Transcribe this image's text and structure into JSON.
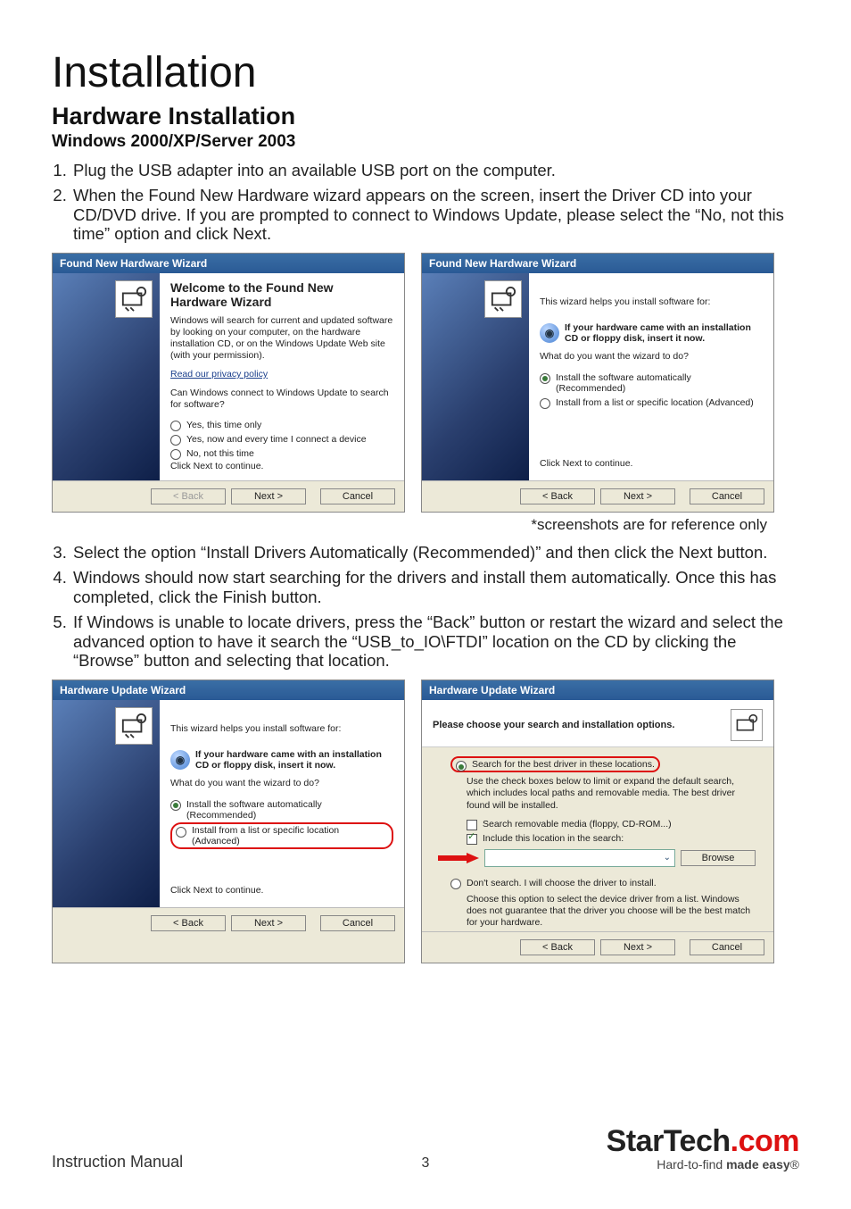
{
  "doc": {
    "title": "Installation",
    "subtitle": "Hardware Installation",
    "subsub": "Windows 2000/XP/Server 2003",
    "steps1": [
      "Plug the USB adapter into an available USB port on the computer.",
      "When the Found New Hardware wizard appears on the screen, insert the Driver CD into your CD/DVD drive. If you are prompted to connect to Windows Update, please select the “No, not this time” option and click Next."
    ],
    "caption": "*screenshots are for reference only",
    "steps2": [
      "Select the option “Install Drivers Automatically (Recommended)” and then click the Next button.",
      "Windows should now start searching for the drivers and install them automatically. Once this has completed, click the Finish button.",
      "If Windows is unable to locate drivers, press the “Back” button or restart the wizard and select the advanced option to have it search the “USB_to_IO\\FTDI” location on the CD by clicking the “Browse” button and selecting that location."
    ]
  },
  "wizA": {
    "title": "Found New Hardware Wizard",
    "heading": "Welcome to the Found New Hardware Wizard",
    "intro": "Windows will search for current and updated software by looking on your computer, on the hardware installation CD, or on the Windows Update Web site (with your permission).",
    "privacy": "Read our privacy policy",
    "question": "Can Windows connect to Windows Update to search for software?",
    "opts": [
      "Yes, this time only",
      "Yes, now and every time I connect a device",
      "No, not this time"
    ],
    "cont": "Click Next to continue.",
    "btns": {
      "back": "< Back",
      "next": "Next >",
      "cancel": "Cancel"
    }
  },
  "wizB": {
    "title": "Found New Hardware Wizard",
    "intro": "This wizard helps you install software for:",
    "hint": "If your hardware came with an installation CD or floppy disk, insert it now.",
    "question": "What do you want the wizard to do?",
    "opts": [
      "Install the software automatically (Recommended)",
      "Install from a list or specific location (Advanced)"
    ],
    "cont": "Click Next to continue.",
    "btns": {
      "back": "< Back",
      "next": "Next >",
      "cancel": "Cancel"
    }
  },
  "wizC": {
    "title": "Hardware Update Wizard",
    "intro": "This wizard helps you install software for:",
    "hint": "If your hardware came with an installation CD or floppy disk, insert it now.",
    "question": "What do you want the wizard to do?",
    "opts": [
      "Install the software automatically (Recommended)",
      "Install from a list or specific location (Advanced)"
    ],
    "cont": "Click Next to continue.",
    "btns": {
      "back": "< Back",
      "next": "Next >",
      "cancel": "Cancel"
    }
  },
  "wizD": {
    "title": "Hardware Update Wizard",
    "heading": "Please choose your search and installation options.",
    "opt1": "Search for the best driver in these locations.",
    "desc1": "Use the check boxes below to limit or expand the default search, which includes local paths and removable media. The best driver found will be installed.",
    "cb1": "Search removable media (floppy, CD-ROM...)",
    "cb2": "Include this location in the search:",
    "browse": "Browse",
    "dropdown_glyph": "⌄",
    "opt2": "Don't search. I will choose the driver to install.",
    "desc2": "Choose this option to select the device driver from a list. Windows does not guarantee that the driver you choose will be the best match for your hardware.",
    "btns": {
      "back": "< Back",
      "next": "Next >",
      "cancel": "Cancel"
    }
  },
  "footer": {
    "manual": "Instruction Manual",
    "page": "3",
    "brand_a": "StarTech",
    "brand_b": ".com",
    "tagline_a": "Hard-to-find ",
    "tagline_b": "made easy",
    "reg": "®"
  }
}
